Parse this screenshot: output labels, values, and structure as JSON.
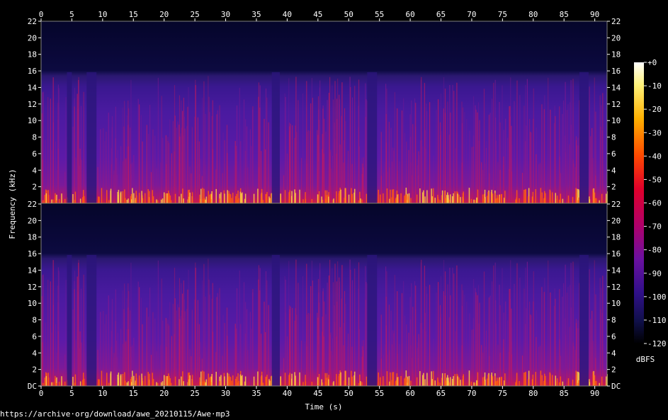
{
  "source_url": "https://archive·org/download/awe_20210115/Awe·mp3",
  "chart_data": {
    "type": "heatmap",
    "title": "",
    "xlabel": "Time (s)",
    "ylabel": "Frequency (kHz)",
    "xlim": [
      0,
      92
    ],
    "ylim": [
      0,
      22
    ],
    "x_ticks": [
      "0",
      "5",
      "10",
      "15",
      "20",
      "25",
      "30",
      "35",
      "40",
      "45",
      "50",
      "55",
      "60",
      "65",
      "70",
      "75",
      "80",
      "85",
      "90"
    ],
    "y_ticks_top": [
      "22",
      "20",
      "18",
      "16",
      "14",
      "12",
      "10",
      "8",
      "6",
      "4",
      "2"
    ],
    "y_ticks_bottom": [
      "22",
      "20",
      "18",
      "16",
      "14",
      "12",
      "10",
      "8",
      "6",
      "4",
      "2",
      "DC"
    ],
    "channels": 2,
    "colorbar": {
      "label": "dBFS",
      "range": [
        -120,
        0
      ],
      "ticks": [
        "+0",
        "-10",
        "-20",
        "-30",
        "-40",
        "-50",
        "-60",
        "-70",
        "-80",
        "-90",
        "-100",
        "-110",
        "-120"
      ]
    },
    "colors": {
      "background": "#000000",
      "spectrum_low": "#05052a",
      "spectrum_mid": "#5a18a0",
      "spectrum_high": "#ff2a10",
      "spectrum_peak": "#ffe060"
    }
  }
}
